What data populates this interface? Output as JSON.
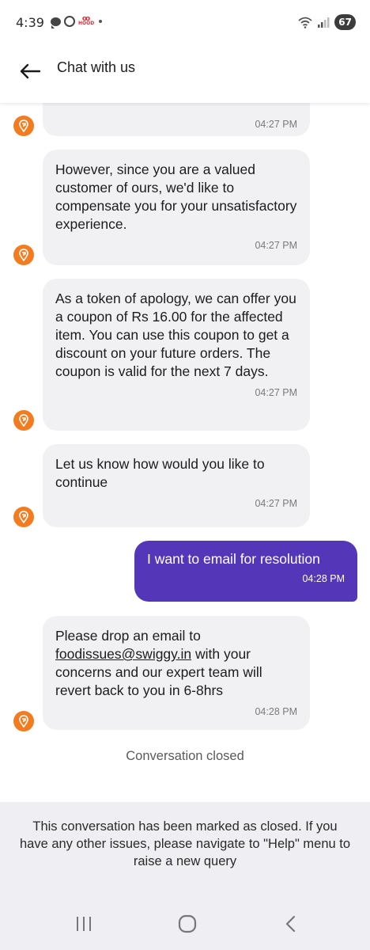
{
  "status_bar": {
    "time": "4:39",
    "battery": "67",
    "left_icons": [
      "chat-bubble-icon",
      "whatsapp-icon",
      "hood-app-icon",
      "dot-icon"
    ],
    "right_icons": [
      "wifi-icon",
      "signal-icon",
      "battery-icon"
    ],
    "hood_label": "HOOD"
  },
  "header": {
    "title": "Chat with us",
    "back_icon": "arrow-left-icon"
  },
  "messages": [
    {
      "sender": "bot",
      "text": "",
      "time": "04:27 PM"
    },
    {
      "sender": "bot",
      "text": "However, since you are a valued customer of ours, we'd like to compensate you for your unsatisfactory experience.",
      "time": "04:27 PM"
    },
    {
      "sender": "bot",
      "text": "As a token of apology, we can offer you a coupon of Rs 16.00 for the affected item. You can use this coupon to get a discount on your future orders. The coupon is valid for the next 7 days.",
      "time": "04:27 PM"
    },
    {
      "sender": "bot",
      "text": "Let us know how would you like to continue",
      "time": "04:27 PM"
    },
    {
      "sender": "user",
      "text": "I want to email for resolution",
      "time": "04:28 PM"
    },
    {
      "sender": "bot",
      "text_before": "Please drop an email to",
      "email": "foodissues@swiggy.in",
      "text_after": "with your concerns and our expert team will revert back to you in 6-8hrs",
      "time": "04:28 PM"
    }
  ],
  "conversation_status": "Conversation closed",
  "closed_notice": "This conversation has been marked as closed. If you have any other issues, please navigate to \"Help\" menu to raise a new query",
  "nav": {
    "recent_icon": "recent-apps-icon",
    "home_icon": "home-icon",
    "back_icon": "back-chevron-icon"
  },
  "colors": {
    "accent": "#5337b8",
    "bot_bubble": "#f1f1f4",
    "avatar": "#f47c20",
    "footer_bg": "#efeff3"
  }
}
